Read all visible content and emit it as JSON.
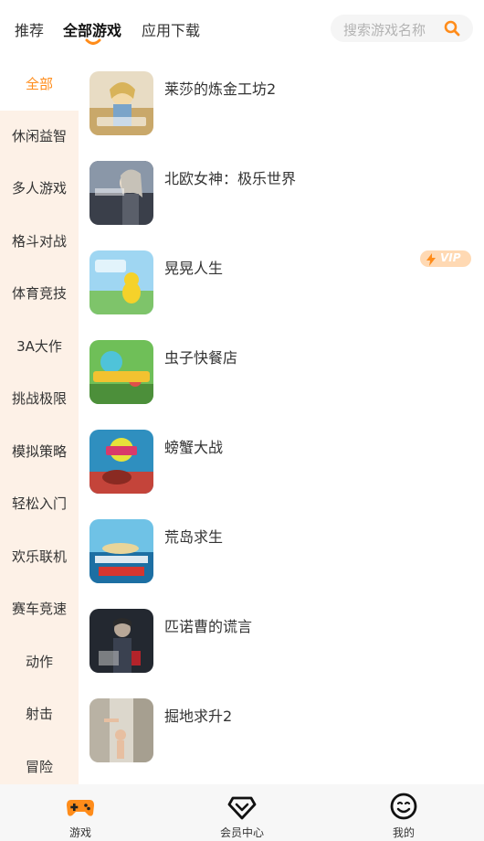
{
  "top_tabs": [
    {
      "label": "推荐",
      "active": false
    },
    {
      "label": "全部游戏",
      "active": true
    },
    {
      "label": "应用下载",
      "active": false
    }
  ],
  "search": {
    "placeholder": "搜索游戏名称",
    "icon": "search-icon"
  },
  "categories": [
    {
      "label": "全部",
      "active": true
    },
    {
      "label": "休闲益智"
    },
    {
      "label": "多人游戏"
    },
    {
      "label": "格斗对战"
    },
    {
      "label": "体育竞技"
    },
    {
      "label": "3A大作"
    },
    {
      "label": "挑战极限"
    },
    {
      "label": "模拟策略"
    },
    {
      "label": "轻松入门"
    },
    {
      "label": "欢乐联机"
    },
    {
      "label": "赛车竞速"
    },
    {
      "label": "动作"
    },
    {
      "label": "射击"
    },
    {
      "label": "冒险"
    }
  ],
  "games": [
    {
      "name": "莱莎的炼金工坊2",
      "vip": false
    },
    {
      "name": "北欧女神：极乐世界",
      "vip": false
    },
    {
      "name": "晃晃人生",
      "vip": true,
      "vip_label": "VIP"
    },
    {
      "name": "虫子快餐店",
      "vip": false
    },
    {
      "name": "螃蟹大战",
      "vip": false
    },
    {
      "name": "荒岛求生",
      "vip": false
    },
    {
      "name": "匹诺曹的谎言",
      "vip": false
    },
    {
      "name": "掘地求升2",
      "vip": false
    }
  ],
  "bottom_nav": [
    {
      "label": "游戏",
      "icon": "gamepad-icon"
    },
    {
      "label": "会员中心",
      "icon": "diamond-icon"
    },
    {
      "label": "我的",
      "icon": "smiley-face-icon"
    }
  ],
  "colors": {
    "accent": "#ff8c1a",
    "sidebar_bg": "#fdf1e7",
    "vip_bg": "#ffd9b3"
  }
}
